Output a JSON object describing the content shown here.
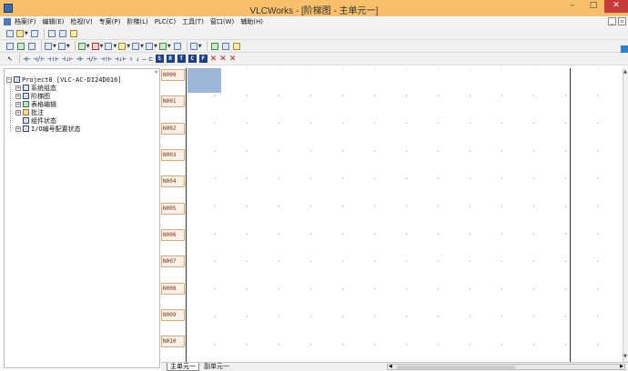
{
  "window": {
    "title": "VLCWorks - [阶梯图 - 主单元一]",
    "min_glyph": "–",
    "max_glyph": "□",
    "close_glyph": "✕"
  },
  "menu": {
    "items": [
      "档案(F)",
      "编辑(E)",
      "检视(V)",
      "专案(P)",
      "阶梯(L)",
      "PLC(C)",
      "工具(T)",
      "窗口(W)",
      "辅助(H)"
    ],
    "mdi_min": "_",
    "mdi_restore": "▫"
  },
  "toolbar3": {
    "ladder_symbols": [
      "⊣⊢",
      "⊣/⊢",
      "⊣↑⊢",
      "⊣↓⊢",
      "⊣⊢",
      "⊣/⊢",
      "⊣↑⊢",
      "⊣↓⊢",
      "↑",
      "↓",
      "—",
      "⊏"
    ],
    "box_letters": [
      "S",
      "R",
      "T",
      "C",
      "F"
    ],
    "delete_glyphs": [
      "✕",
      "✕",
      "✕"
    ]
  },
  "tree": {
    "panel_close": "×",
    "root": {
      "label": "Project0 [VLC-AC-DI24D016]",
      "expander": "−"
    },
    "children": [
      {
        "label": "系统组态",
        "expander": "+"
      },
      {
        "label": "阶梯图",
        "expander": "+"
      },
      {
        "label": "表格编辑",
        "expander": "+"
      },
      {
        "label": "批注",
        "expander": "+"
      },
      {
        "label": "组件状态",
        "expander": ""
      },
      {
        "label": "I/O编号配置状态",
        "expander": "+"
      }
    ]
  },
  "ladder": {
    "rungs": [
      "N000",
      "N001",
      "N002",
      "N003",
      "N004",
      "N005",
      "N006",
      "N007",
      "N008",
      "N009",
      "N010"
    ]
  },
  "tabs": {
    "active": "主单元一",
    "inactive": "副单元一"
  },
  "colors": {
    "titlebar": "#f8c06a",
    "cursor": "#9db6d6",
    "rung_label": "#7a2c10"
  }
}
